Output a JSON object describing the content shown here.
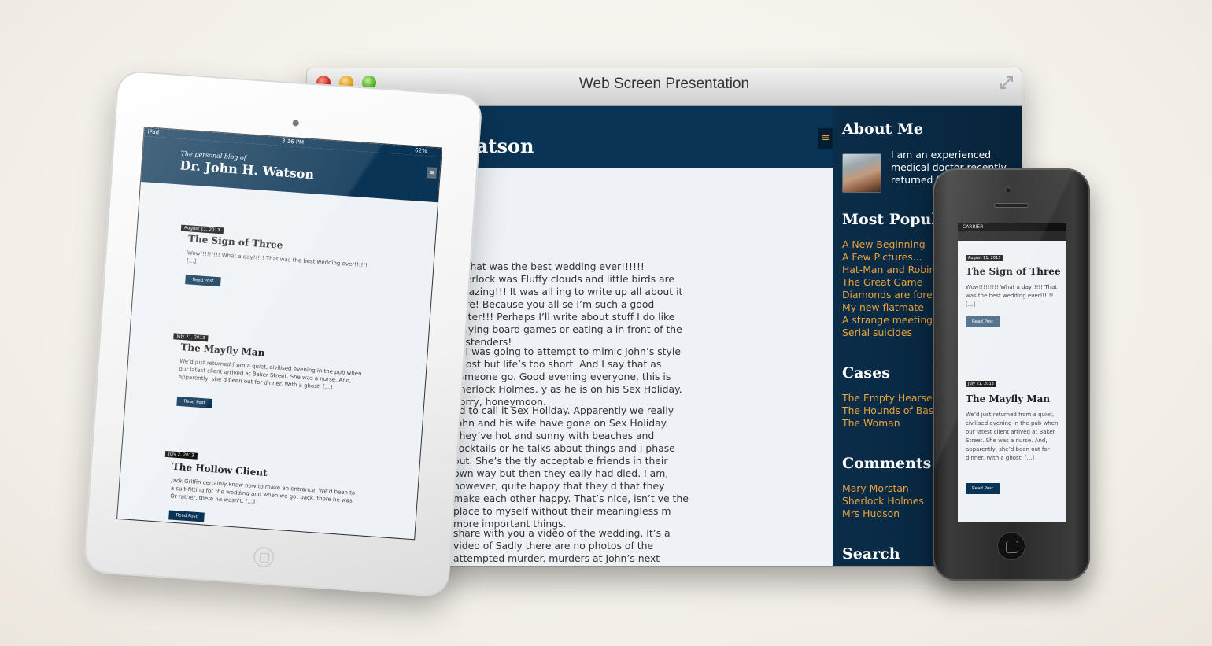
{
  "window": {
    "title": "Web Screen Presentation"
  },
  "desktop_site": {
    "header_title_fragment": "Watson",
    "menu_icon_glyph": "≡",
    "post_title_fragment": "e",
    "paragraphs": [
      "!! That was the best wedding ever!!!!!! Sherlock was Fluffy clouds and little birds are amazing!!! It was all ing to write up all about it here! Because you all se I’m such a good writer!!! Perhaps I’ll write about stuff I do like playing board games or eating a in front of the Eastenders!",
      "e. I was going to attempt to mimic John’s style of ost but life’s too short. And I say that as someone go. Good evening everyone, this is Sherlock Holmes. y as he is on his Sex Holiday. Sorry, honeymoon.",
      "ed to call it Sex Holiday. Apparently we really John and his wife have gone on Sex Holiday. They’ve hot and sunny with beaches and cocktails or he talks about things and I phase out. She’s the tly acceptable friends in their own way but then they eally had died. I am, however, quite happy that they d that they make each other happy. That’s nice, isn’t ve the place to myself without their meaningless m more important things.",
      "share with you a video of the wedding. It’s a video of Sadly there are no photos of the attempted murder. murders at John’s next wedding, I promise to take"
    ],
    "sidebar": {
      "about_heading": "About Me",
      "about_text": "I am an experienced medical doctor recently returned from Afgh",
      "most_popular_heading": "Most Popular",
      "most_popular": [
        "A New Beginning",
        "A Few Pictures...",
        "Hat-Man and Robin",
        "The Great Game",
        "Diamonds are forever",
        "My new flatmate",
        "A strange meeting",
        "Serial suicides"
      ],
      "cases_heading": "Cases",
      "cases": [
        "The Empty Hearse",
        "The Hounds of Baskerville",
        "The Woman"
      ],
      "comments_heading": "Comments By",
      "comments": [
        "Mary Morstan",
        "Sherlock Holmes",
        "Mrs Hudson"
      ],
      "search_heading": "Search"
    }
  },
  "ipad_site": {
    "status": {
      "carrier": "iPad",
      "time": "3:16 PM",
      "battery": "62%"
    },
    "header_sub": "The personal blog of",
    "header_title": "Dr. John H. Watson",
    "menu_icon_glyph": "≡",
    "posts": [
      {
        "date": "August 11, 2013",
        "title": "The Sign of Three",
        "excerpt": "Wow!!!!!!!!! What a day!!!!! That was the best wedding ever!!!!!! [...]",
        "button": "Read Post"
      },
      {
        "date": "July 21, 2013",
        "title": "The Mayfly Man",
        "excerpt": "We’d just returned from a quiet, civilised evening in the pub when our latest client arrived at Baker Street. She was a nurse. And, apparently, she’d been out for dinner. With a ghost. [...]",
        "button": "Read Post"
      },
      {
        "date": "July 2, 2013",
        "title": "The Hollow Client",
        "excerpt": "Jack Griffin certainly knew how to make an entrance. We’d been to a suit-fitting for the wedding and when we got back, there he was. Or rather, there he wasn’t. [...]",
        "button": "Read Post"
      }
    ]
  },
  "iphone_site": {
    "status": {
      "carrier": "CARRIER"
    },
    "posts": [
      {
        "date": "August 11, 2013",
        "title": "The Sign of Three",
        "excerpt": "Wow!!!!!!!!! What a day!!!!! That was the best wedding ever!!!!!! [...]",
        "button": "Read Post"
      },
      {
        "date": "July 21, 2013",
        "title": "The Mayfly Man",
        "excerpt": "We’d just returned from a quiet, civilised evening in the pub when our latest client arrived at Baker Street. She was a nurse. And, apparently, she’d been out for dinner. With a ghost. [...]",
        "button": "Read Post"
      }
    ]
  },
  "colors": {
    "brand_navy": "#0a3455",
    "link_orange": "#e8a33c",
    "page_bg": "#eef2f6"
  }
}
